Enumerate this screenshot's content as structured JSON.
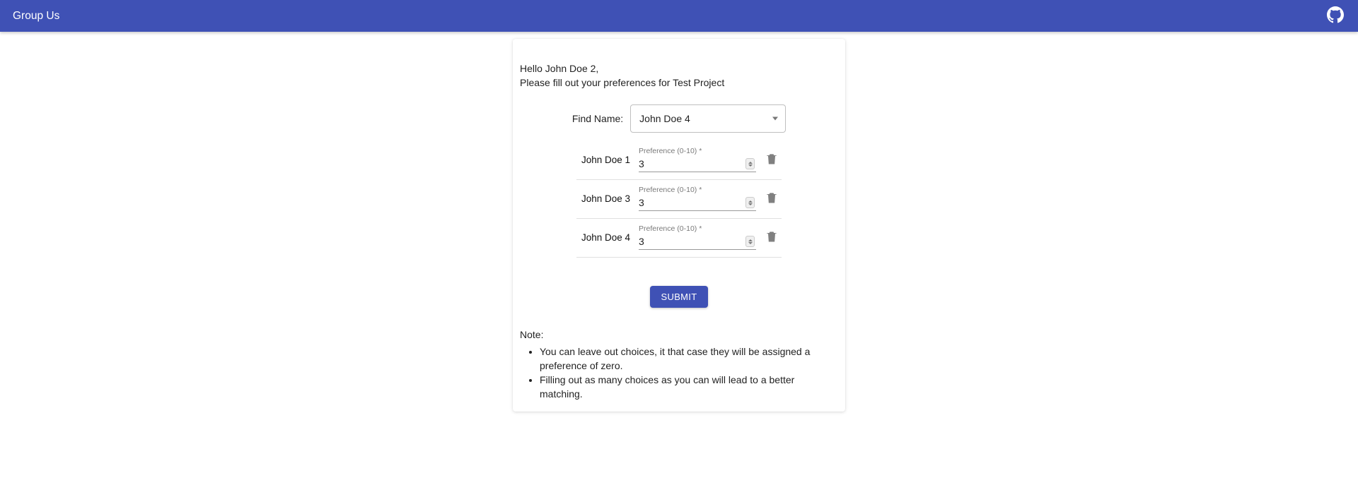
{
  "header": {
    "title": "Group Us"
  },
  "greeting": {
    "line1": "Hello John Doe 2,",
    "line2": "Please fill out your preferences for Test Project"
  },
  "find": {
    "label": "Find Name:",
    "selected": "John Doe 4"
  },
  "pref_label": "Preference (0-10) *",
  "preferences": [
    {
      "name": "John Doe 1",
      "value": "3"
    },
    {
      "name": "John Doe 3",
      "value": "3"
    },
    {
      "name": "John Doe 4",
      "value": "3"
    }
  ],
  "submit_label": "Submit",
  "note_title": "Note:",
  "notes": [
    "You can leave out choices, it that case they will be assigned a preference of zero.",
    "Filling out as many choices as you can will lead to a better matching."
  ]
}
